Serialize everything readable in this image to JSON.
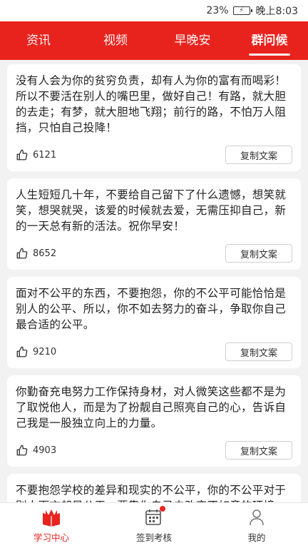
{
  "status_bar": {
    "battery": "23%",
    "time": "晚上8:03"
  },
  "tabs": [
    {
      "label": "资讯",
      "active": false
    },
    {
      "label": "视频",
      "active": false
    },
    {
      "label": "早晚安",
      "active": false
    },
    {
      "label": "群问候",
      "active": true
    }
  ],
  "cards": [
    {
      "text": "没有人会为你的贫穷负责，却有人为你的富有而喝彩！所以不要活在别人的嘴巴里，做好自己！有路，就大胆的去走；有梦，就大胆地飞翔；前行的路，不怕万人阻挡，只怕自己投降！",
      "likes": "6121",
      "copy_label": "复制文案"
    },
    {
      "text": "人生短短几十年，不要给自己留下了什么遗憾，想笑就笑，想哭就哭，该爱的时候就去爱，无需压抑自己，新的一天总有新的活法。祝你早安！",
      "likes": "8652",
      "copy_label": "复制文案"
    },
    {
      "text": "面对不公平的东西，不要抱怨，你的不公平可能恰恰是别人的公平、所以，你不如去努力的奋斗，争取你自己最合适的公平。",
      "likes": "9210",
      "copy_label": "复制文案"
    },
    {
      "text": "你勤奋充电努力工作保持身材，对人微笑这些都不是为了取悦他人，而是为了扮靓自己照亮自己的心，告诉自己我是一股独立向上的力量。",
      "likes": "4903",
      "copy_label": "复制文案"
    },
    {
      "text": "不要抱怨学校的差异和现实的不公平，你的不公平对于别人而言却是公平，要靠你自己去改变不如意的环境，争取合理的公平。",
      "likes": "",
      "copy_label": ""
    }
  ],
  "bottom_nav": [
    {
      "label": "学习中心",
      "icon": "book-icon",
      "active": true
    },
    {
      "label": "签到考核",
      "icon": "calendar-icon",
      "active": false
    },
    {
      "label": "我的",
      "icon": "person-icon",
      "active": false
    }
  ],
  "colors": {
    "accent": "#e8231e"
  }
}
